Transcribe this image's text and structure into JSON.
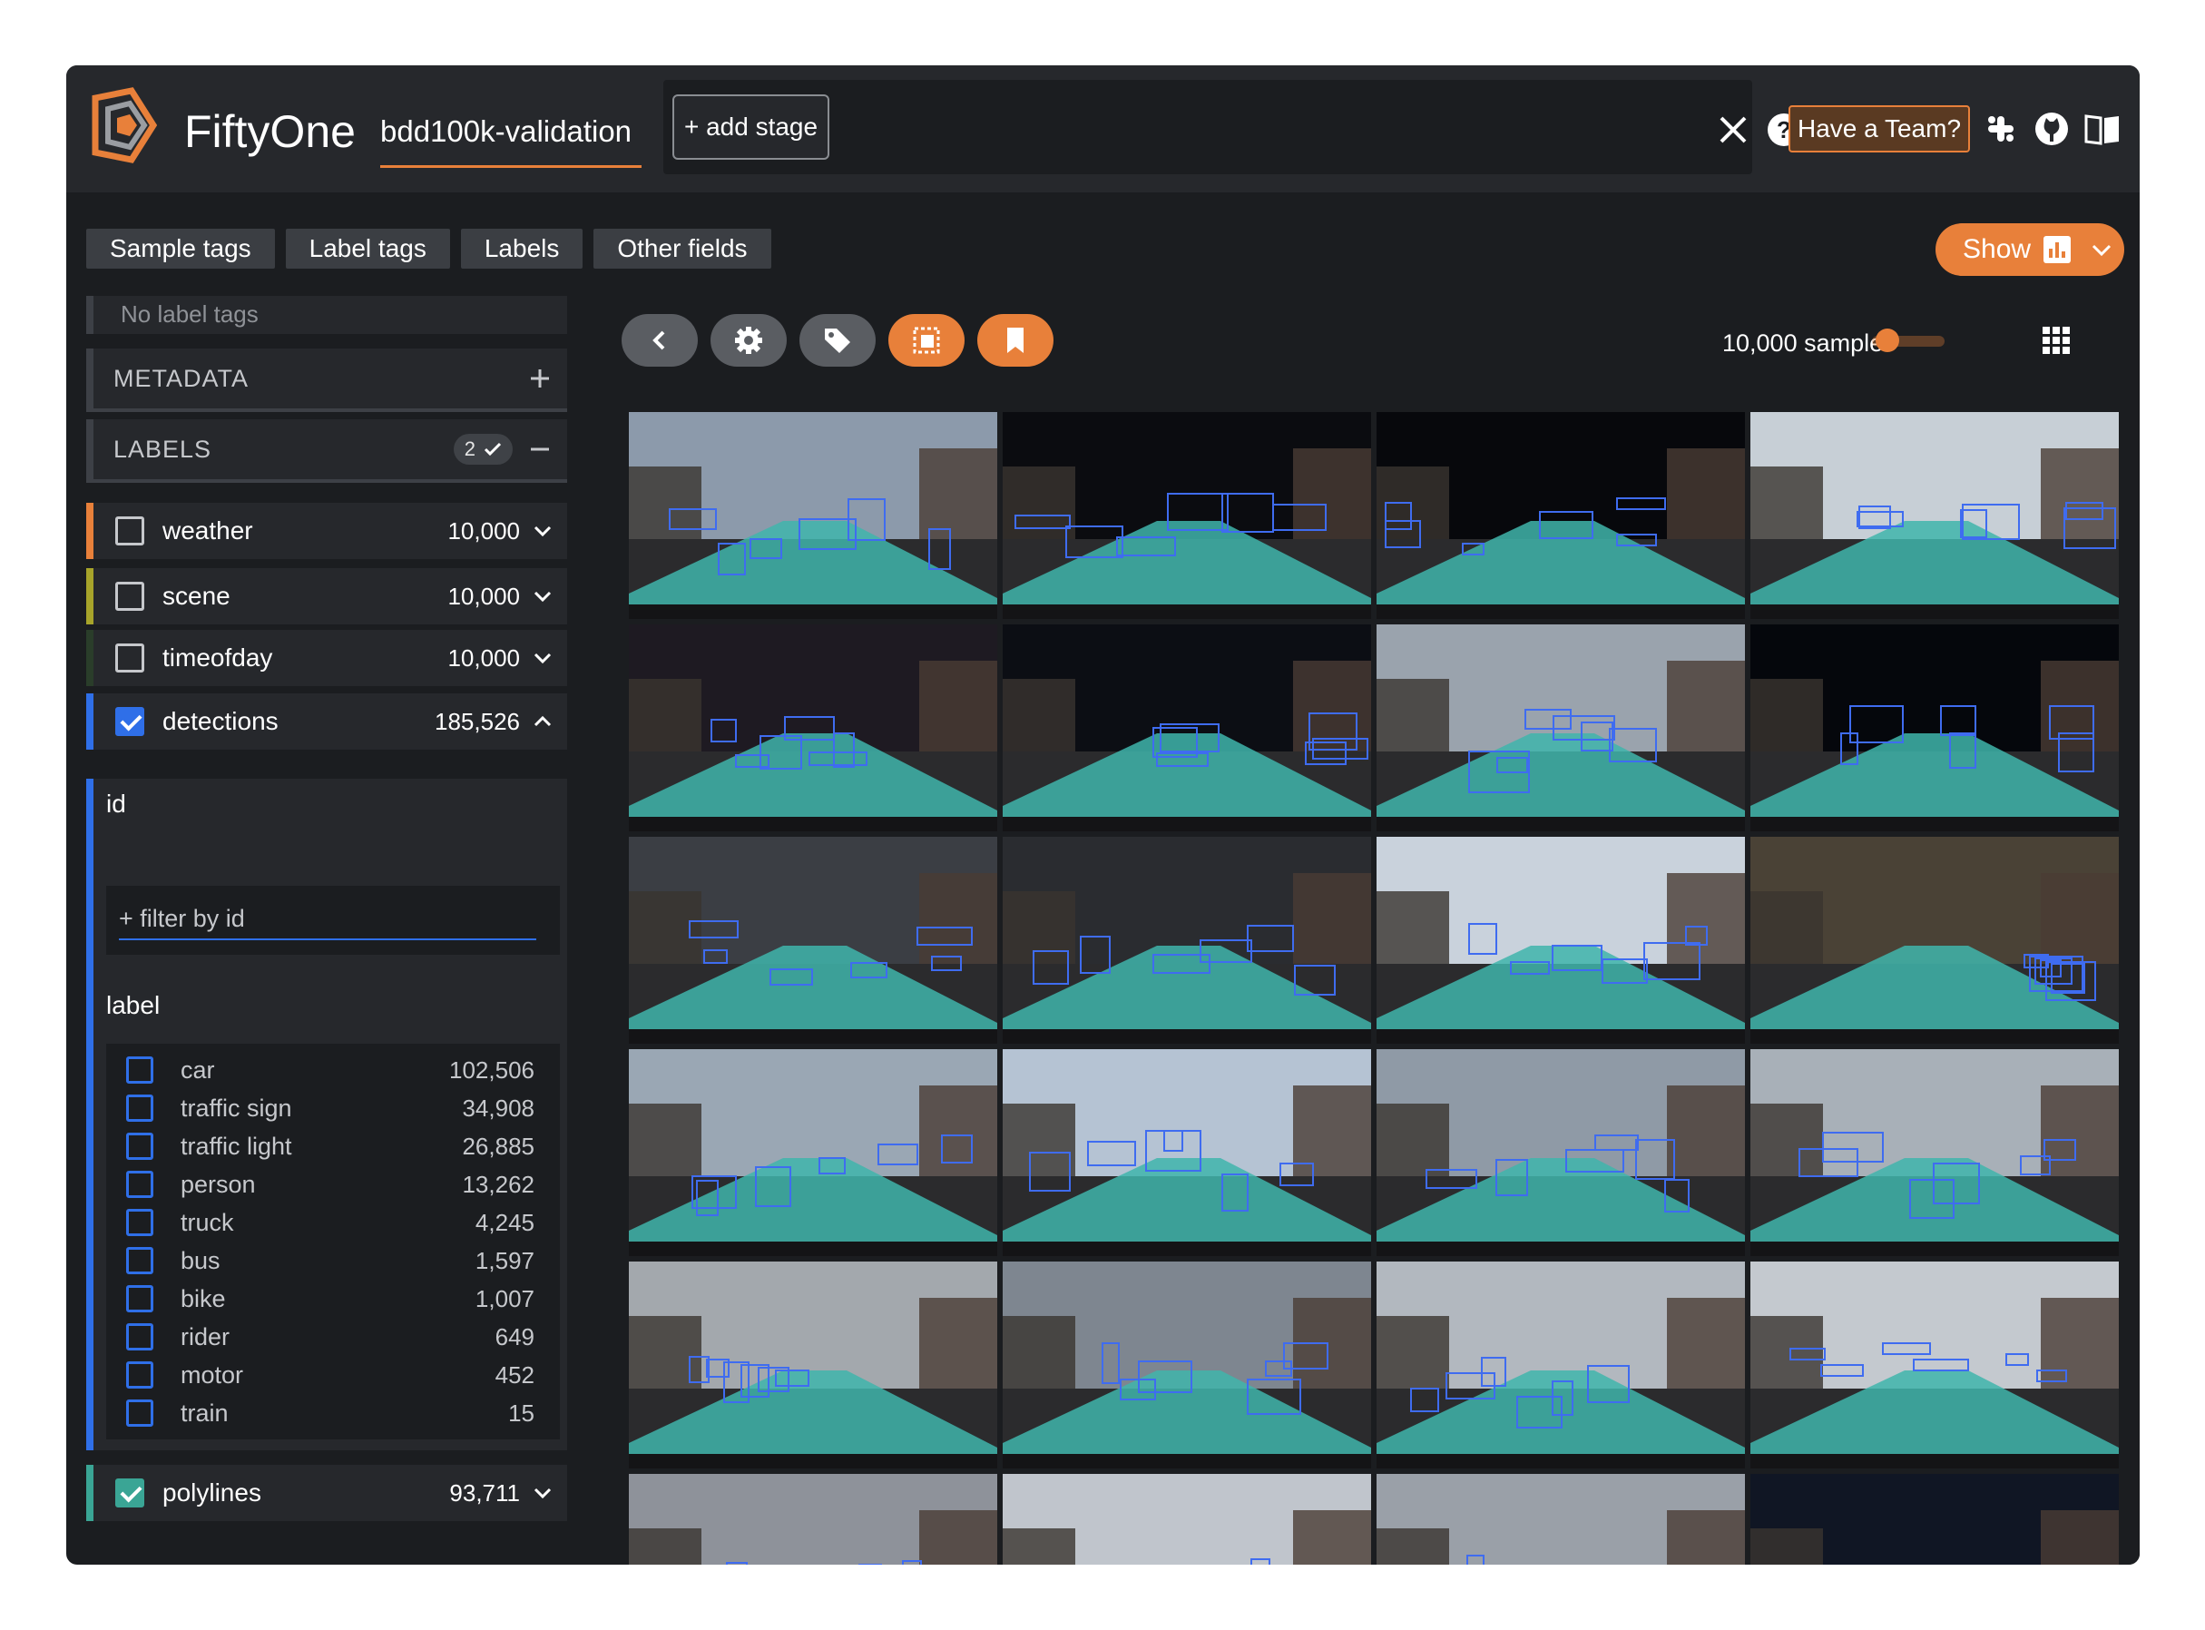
{
  "app": {
    "title": "FiftyOne",
    "dataset": "bdd100k-validation"
  },
  "viewbar": {
    "add_stage": "+ add stage"
  },
  "header": {
    "team_button": "Have a Team?"
  },
  "tabs": [
    "Sample tags",
    "Label tags",
    "Labels",
    "Other fields"
  ],
  "show_button": {
    "label": "Show"
  },
  "sidebar": {
    "no_label_tags": "No label tags",
    "metadata": "METADATA",
    "labels_group": "LABELS",
    "labels_selected": "2",
    "fields": [
      {
        "name": "weather",
        "count": "10,000",
        "checked": false,
        "color": "#e8803a"
      },
      {
        "name": "scene",
        "count": "10,000",
        "checked": false,
        "color": "#a7a42a"
      },
      {
        "name": "timeofday",
        "count": "10,000",
        "checked": false,
        "color": "#2a3d2a"
      },
      {
        "name": "detections",
        "count": "185,526",
        "checked": true,
        "color": "#2f6fe8"
      },
      {
        "name": "polylines",
        "count": "93,711",
        "checked": true,
        "color": "#3aa595"
      }
    ],
    "detections_panel": {
      "id_label": "id",
      "filter_placeholder": "+ filter by id",
      "label_label": "label",
      "labels": [
        {
          "name": "car",
          "count": "102,506"
        },
        {
          "name": "traffic sign",
          "count": "34,908"
        },
        {
          "name": "traffic light",
          "count": "26,885"
        },
        {
          "name": "person",
          "count": "13,262"
        },
        {
          "name": "truck",
          "count": "4,245"
        },
        {
          "name": "bus",
          "count": "1,597"
        },
        {
          "name": "bike",
          "count": "1,007"
        },
        {
          "name": "rider",
          "count": "649"
        },
        {
          "name": "motor",
          "count": "452"
        },
        {
          "name": "train",
          "count": "15"
        }
      ]
    }
  },
  "main": {
    "sample_count": "10,000 samples"
  },
  "colors": {
    "accent": "#e8803a",
    "selection": "#2f6fe8",
    "lane": "#3fb5ab"
  }
}
